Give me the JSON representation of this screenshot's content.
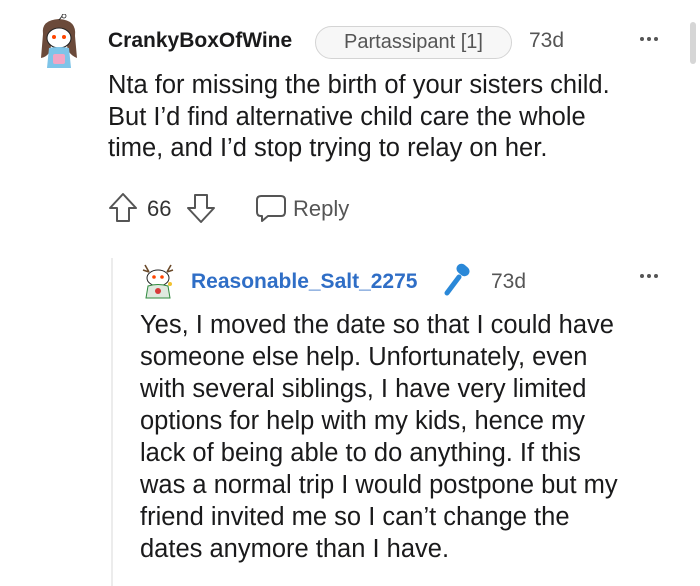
{
  "colors": {
    "username_op": "#1a1a1b",
    "username_reply": "#2f6ec6",
    "meta_text": "#555555",
    "thread_line": "#ececec"
  },
  "comment": {
    "username": "CrankyBoxOfWine",
    "flair": "Partassipant [1]",
    "time": "73d",
    "avatar_icon": "snoo-avatar-icon",
    "body_lines": [
      "Nta for missing the birth of your sisters child.",
      "But I’d find alternative child care the whole",
      "time, and I’d stop trying to relay on her."
    ],
    "votes": "66",
    "reply_label": "Reply"
  },
  "reply": {
    "username": "Reasonable_Salt_2275",
    "time": "73d",
    "op_badge_icon": "microphone-icon",
    "avatar_icon": "snoo-avatar-icon",
    "body_lines": [
      "Yes, I moved the date so that I could have",
      "someone else help. Unfortunately, even",
      "with several siblings, I have very limited",
      "options for help with my kids, hence my",
      "lack of being able to do anything. If this",
      "was a normal trip I would postpone but my",
      "friend invited me so I can’t change the",
      "dates anymore than I have."
    ]
  }
}
